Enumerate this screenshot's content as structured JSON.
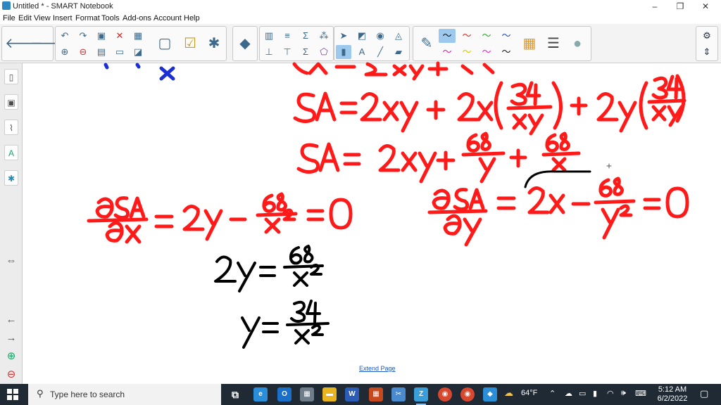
{
  "window": {
    "title": "Untitled * - SMART Notebook",
    "minimize": "–",
    "restore": "❐",
    "close": "✕"
  },
  "menu": [
    "File",
    "Edit",
    "View",
    "Insert",
    "Format",
    "Tools",
    "Add-ons",
    "Account",
    "Help"
  ],
  "icons": {
    "back": "🡐",
    "forward": "🡒",
    "undo": "↶",
    "redo": "↷",
    "delete": "✕",
    "sigma": "Σ",
    "text": "A",
    "settings": "⚙",
    "arrows": "⇕"
  },
  "canvas": {
    "extend_page": "Extend Page"
  },
  "ink_colors": {
    "red": "#ff1a1a",
    "blue": "#1a2fd6",
    "black": "#000000"
  },
  "taskbar": {
    "search_placeholder": "Type here to search",
    "weather": "64°F",
    "time": "5:12 AM",
    "date": "6/2/2022"
  }
}
